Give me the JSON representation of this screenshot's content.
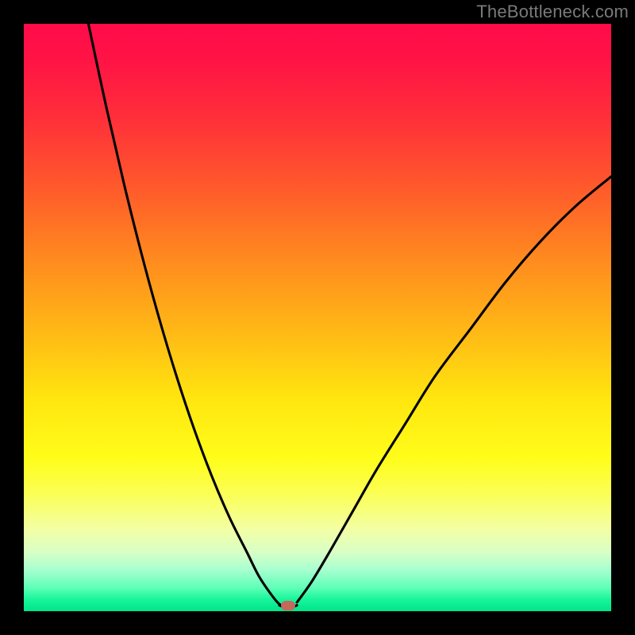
{
  "watermark": "TheBottleneck.com",
  "colors": {
    "frame": "#000000",
    "curve": "#000000",
    "marker": "#c46a5a",
    "gradient_stops": [
      "#ff0b49",
      "#ff1345",
      "#ff2f3a",
      "#ff5a2b",
      "#ff8a1f",
      "#ffb716",
      "#ffe60f",
      "#fffd1a",
      "#fbff55",
      "#f3ffa4",
      "#d8ffc6",
      "#a6ffd0",
      "#5fffb7",
      "#18f59a",
      "#00e48b"
    ]
  },
  "chart_data": {
    "type": "line",
    "title": "",
    "xlabel": "",
    "ylabel": "",
    "xlim": [
      0,
      100
    ],
    "ylim": [
      0,
      100
    ],
    "annotations": [
      {
        "name": "marker",
        "x": 45,
        "y": 1,
        "shape": "pill",
        "color": "#c46a5a"
      }
    ],
    "series": [
      {
        "name": "left-branch",
        "x": [
          11,
          14,
          17,
          20,
          23,
          26,
          29,
          32,
          35,
          38,
          40,
          42,
          43.5,
          45
        ],
        "y": [
          100,
          86,
          73,
          61,
          50,
          40,
          31,
          23,
          16,
          10,
          6,
          3,
          1.2,
          0.5
        ]
      },
      {
        "name": "valley-floor",
        "x": [
          43.5,
          45,
          46.5
        ],
        "y": [
          1.0,
          0.5,
          1.0
        ]
      },
      {
        "name": "right-branch",
        "x": [
          46.5,
          49,
          52,
          56,
          60,
          65,
          70,
          76,
          82,
          88,
          94,
          100
        ],
        "y": [
          1.5,
          5,
          10,
          17,
          24,
          32,
          40,
          48,
          56,
          63,
          69,
          74
        ]
      }
    ]
  }
}
